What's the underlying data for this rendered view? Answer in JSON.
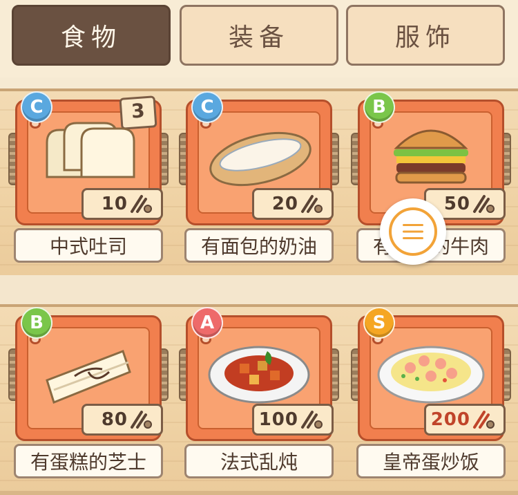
{
  "tabs": [
    {
      "label": "食物",
      "active": true
    },
    {
      "label": "装备",
      "active": false
    },
    {
      "label": "服饰",
      "active": false
    }
  ],
  "grade_colors": {
    "A": "#ee6a6a",
    "B": "#7ac64a",
    "C": "#5aa8df",
    "S": "#f5a623"
  },
  "items": [
    {
      "name": "中式吐司",
      "grade": "C",
      "price": "10",
      "count": "3",
      "food_icon": "toast-icon"
    },
    {
      "name": "有面包的奶油",
      "grade": "C",
      "price": "20",
      "food_icon": "hotdog-bread-icon"
    },
    {
      "name": "有面包的牛肉",
      "grade": "B",
      "price": "50",
      "food_icon": "hamburger-icon"
    },
    {
      "name": "有蛋糕的芝士",
      "grade": "B",
      "price": "80",
      "food_icon": "cheesecake-icon"
    },
    {
      "name": "法式乱炖",
      "grade": "A",
      "price": "100",
      "food_icon": "ratatouille-icon"
    },
    {
      "name": "皇帝蛋炒饭",
      "grade": "S",
      "price": "200",
      "food_icon": "fried-rice-icon",
      "price_highlight": "#c0442a"
    }
  ],
  "menu_button": {
    "icon": "menu-icon"
  }
}
